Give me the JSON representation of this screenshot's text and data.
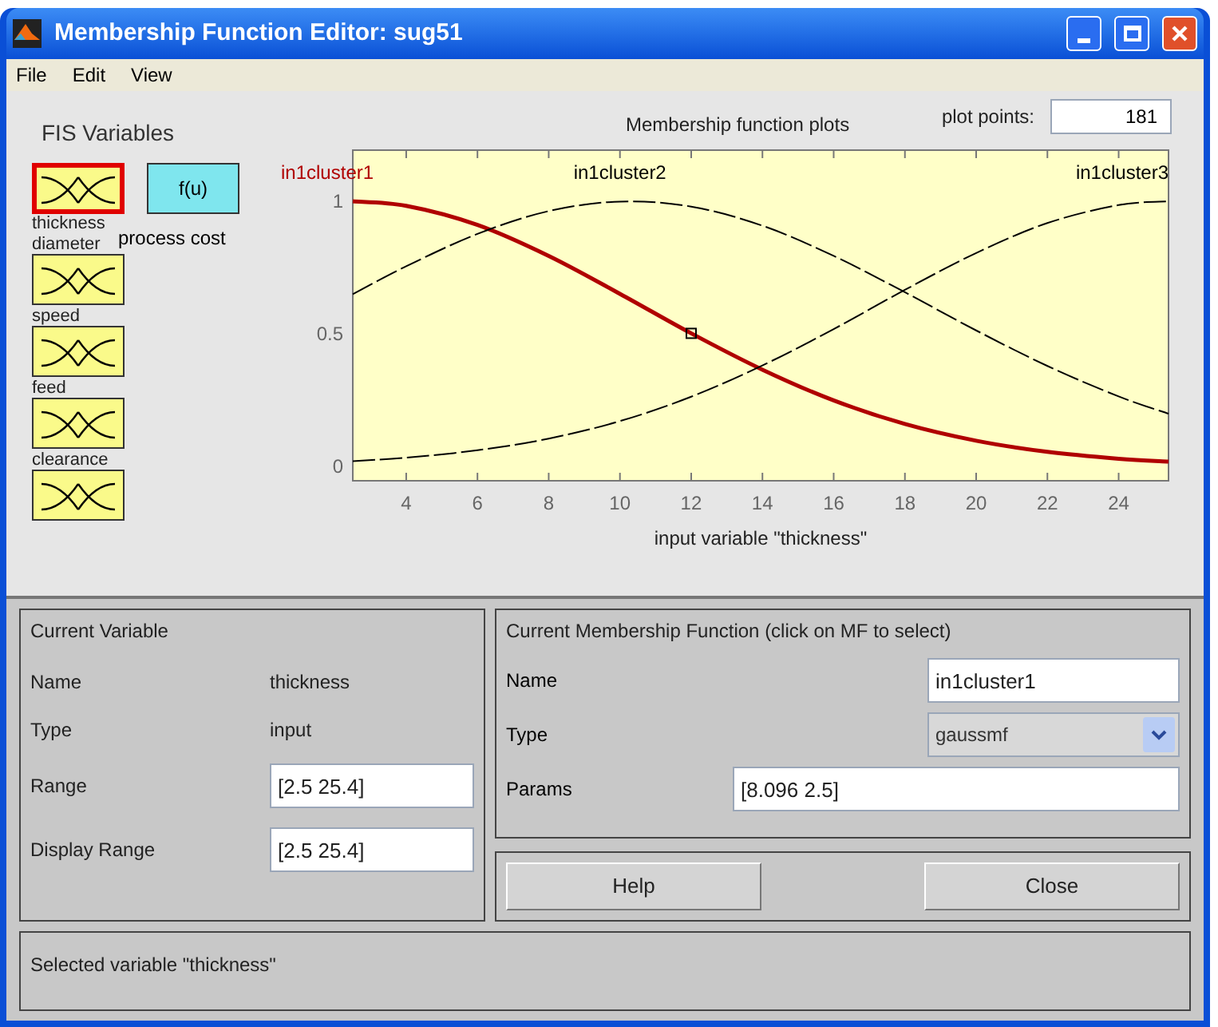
{
  "window": {
    "title": "Membership Function Editor: sug51"
  },
  "menu": [
    "File",
    "Edit",
    "View"
  ],
  "fis_variables": {
    "title": "FIS Variables",
    "items": [
      {
        "name": "thickness",
        "kind": "input",
        "selected": true
      },
      {
        "name": "diameter",
        "kind": "input",
        "selected": false
      },
      {
        "name": "speed",
        "kind": "input",
        "selected": false
      },
      {
        "name": "feed",
        "kind": "input",
        "selected": false
      },
      {
        "name": "clearance",
        "kind": "input",
        "selected": false
      },
      {
        "name": "process cost",
        "kind": "output",
        "selected": false,
        "symbol": "f(u)"
      }
    ]
  },
  "plot": {
    "plot_points_label": "plot points:",
    "plot_points": "181",
    "chart_data": {
      "type": "line",
      "title": "Membership function plots",
      "xlabel": "input variable \"thickness\"",
      "x": [
        2.5,
        4,
        6,
        8,
        10,
        12,
        14,
        16,
        18,
        20,
        22,
        24,
        25.4
      ],
      "series": [
        {
          "name": "in1cluster1",
          "color": "#b00000",
          "line_style": "solid",
          "values": [
            1,
            0.983,
            0.911,
            0.794,
            0.651,
            0.502,
            0.365,
            0.249,
            0.16,
            0.097,
            0.055,
            0.029,
            0.018
          ]
        },
        {
          "name": "in1cluster2",
          "color": "#000000",
          "line_style": "dashed",
          "values": [
            0.65,
            0.755,
            0.877,
            0.963,
            0.999,
            0.98,
            0.908,
            0.794,
            0.657,
            0.513,
            0.379,
            0.264,
            0.199
          ]
        },
        {
          "name": "in1cluster3",
          "color": "#000000",
          "line_style": "dashed",
          "values": [
            0.02,
            0.033,
            0.061,
            0.105,
            0.171,
            0.263,
            0.381,
            0.518,
            0.666,
            0.805,
            0.918,
            0.986,
            1
          ]
        }
      ],
      "xlim": [
        2.5,
        25.4
      ],
      "ylim": [
        -0.054,
        1.193
      ],
      "xticks": [
        4,
        6,
        8,
        10,
        12,
        14,
        16,
        18,
        20,
        22,
        24
      ],
      "yticks": [
        {
          "value": 0,
          "label": "0"
        },
        {
          "value": 0.5,
          "label": "0.5"
        },
        {
          "value": 1,
          "label": "1"
        }
      ]
    }
  },
  "current_variable": {
    "title": "Current Variable",
    "name_label": "Name",
    "name": "thickness",
    "type_label": "Type",
    "type": "input",
    "range_label": "Range",
    "range": "[2.5 25.4]",
    "display_range_label": "Display Range",
    "display_range": "[2.5 25.4]"
  },
  "current_mf": {
    "title": "Current Membership Function (click on MF to select)",
    "name_label": "Name",
    "name": "in1cluster1",
    "type_label": "Type",
    "type": "gaussmf",
    "params_label": "Params",
    "params": "[8.096 2.5]"
  },
  "buttons": [
    "Help",
    "Close"
  ],
  "status": "Selected variable \"thickness\""
}
